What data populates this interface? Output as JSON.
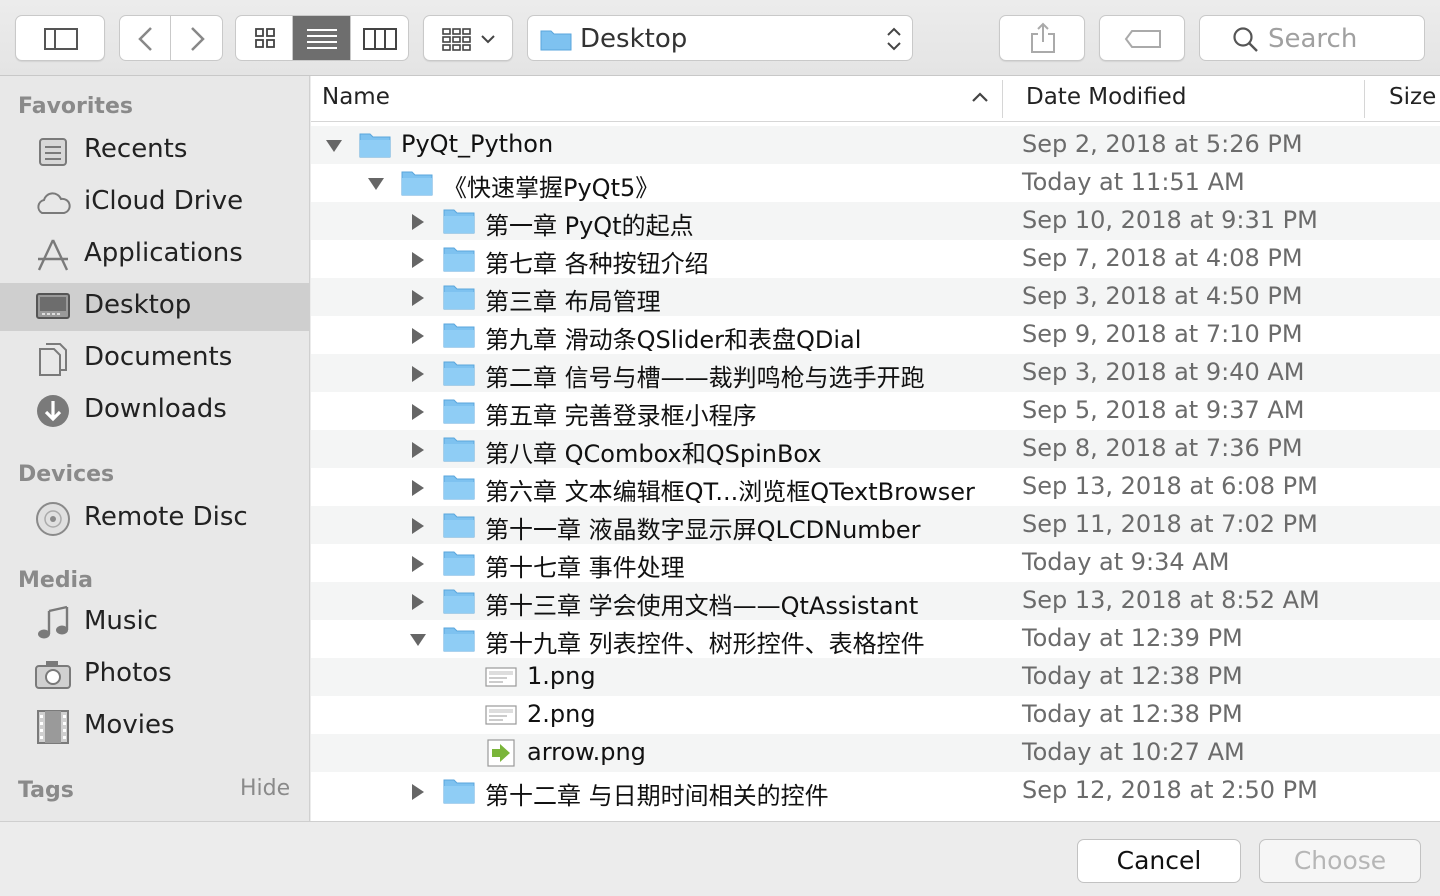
{
  "toolbar": {
    "path_label": "Desktop",
    "search_placeholder": "Search"
  },
  "sidebar": {
    "favorites_title": "Favorites",
    "favorites": [
      {
        "label": "Recents",
        "icon": "recents-icon"
      },
      {
        "label": "iCloud Drive",
        "icon": "cloud-icon"
      },
      {
        "label": "Applications",
        "icon": "applications-icon"
      },
      {
        "label": "Desktop",
        "icon": "desktop-icon",
        "selected": true
      },
      {
        "label": "Documents",
        "icon": "documents-icon"
      },
      {
        "label": "Downloads",
        "icon": "downloads-icon"
      }
    ],
    "devices_title": "Devices",
    "devices": [
      {
        "label": "Remote Disc",
        "icon": "disc-icon"
      }
    ],
    "media_title": "Media",
    "media": [
      {
        "label": "Music",
        "icon": "music-icon"
      },
      {
        "label": "Photos",
        "icon": "camera-icon"
      },
      {
        "label": "Movies",
        "icon": "film-icon"
      }
    ],
    "tags_title": "Tags",
    "tags_hide": "Hide"
  },
  "columns": {
    "name": "Name",
    "date": "Date Modified",
    "size": "Size"
  },
  "rows": [
    {
      "name": "PyQt_Python",
      "date": "Sep 2, 2018 at 5:26 PM",
      "level": 0,
      "type": "folder",
      "expanded": true
    },
    {
      "name": "《快速掌握PyQt5》",
      "date": "Today at 11:51 AM",
      "level": 1,
      "type": "folder",
      "expanded": true
    },
    {
      "name": "第一章  PyQt的起点",
      "date": "Sep 10, 2018 at 9:31 PM",
      "level": 2,
      "type": "folder",
      "expanded": false
    },
    {
      "name": "第七章 各种按钮介绍",
      "date": "Sep 7, 2018 at 4:08 PM",
      "level": 2,
      "type": "folder",
      "expanded": false
    },
    {
      "name": "第三章 布局管理",
      "date": "Sep 3, 2018 at 4:50 PM",
      "level": 2,
      "type": "folder",
      "expanded": false
    },
    {
      "name": "第九章 滑动条QSlider和表盘QDial",
      "date": "Sep 9, 2018 at 7:10 PM",
      "level": 2,
      "type": "folder",
      "expanded": false
    },
    {
      "name": "第二章  信号与槽——裁判鸣枪与选手开跑",
      "date": "Sep 3, 2018 at 9:40 AM",
      "level": 2,
      "type": "folder",
      "expanded": false
    },
    {
      "name": "第五章 完善登录框小程序",
      "date": "Sep 5, 2018 at 9:37 AM",
      "level": 2,
      "type": "folder",
      "expanded": false
    },
    {
      "name": "第八章 QCombox和QSpinBox",
      "date": "Sep 8, 2018 at 7:36 PM",
      "level": 2,
      "type": "folder",
      "expanded": false
    },
    {
      "name": "第六章 文本编辑框QT...浏览框QTextBrowser",
      "date": "Sep 13, 2018 at 6:08 PM",
      "level": 2,
      "type": "folder",
      "expanded": false
    },
    {
      "name": "第十一章 液晶数字显示屏QLCDNumber",
      "date": "Sep 11, 2018 at 7:02 PM",
      "level": 2,
      "type": "folder",
      "expanded": false
    },
    {
      "name": "第十七章 事件处理",
      "date": "Today at 9:34 AM",
      "level": 2,
      "type": "folder",
      "expanded": false
    },
    {
      "name": "第十三章 学会使用文档——QtAssistant",
      "date": "Sep 13, 2018 at 8:52 AM",
      "level": 2,
      "type": "folder",
      "expanded": false
    },
    {
      "name": "第十九章 列表控件、树形控件、表格控件",
      "date": "Today at 12:39 PM",
      "level": 2,
      "type": "folder",
      "expanded": true
    },
    {
      "name": "1.png",
      "date": "Today at 12:38 PM",
      "level": 3,
      "type": "image"
    },
    {
      "name": "2.png",
      "date": "Today at 12:38 PM",
      "level": 3,
      "type": "image"
    },
    {
      "name": "arrow.png",
      "date": "Today at 10:27 AM",
      "level": 3,
      "type": "arrow-image"
    },
    {
      "name": "第十二章 与日期时间相关的控件",
      "date": "Sep 12, 2018 at 2:50 PM",
      "level": 2,
      "type": "folder",
      "expanded": false
    }
  ],
  "footer": {
    "cancel_label": "Cancel",
    "choose_label": "Choose"
  },
  "colors": {
    "folder": "#7ec2f0",
    "selection": "#cfcfcf",
    "active_segment": "#6e6e6e"
  }
}
